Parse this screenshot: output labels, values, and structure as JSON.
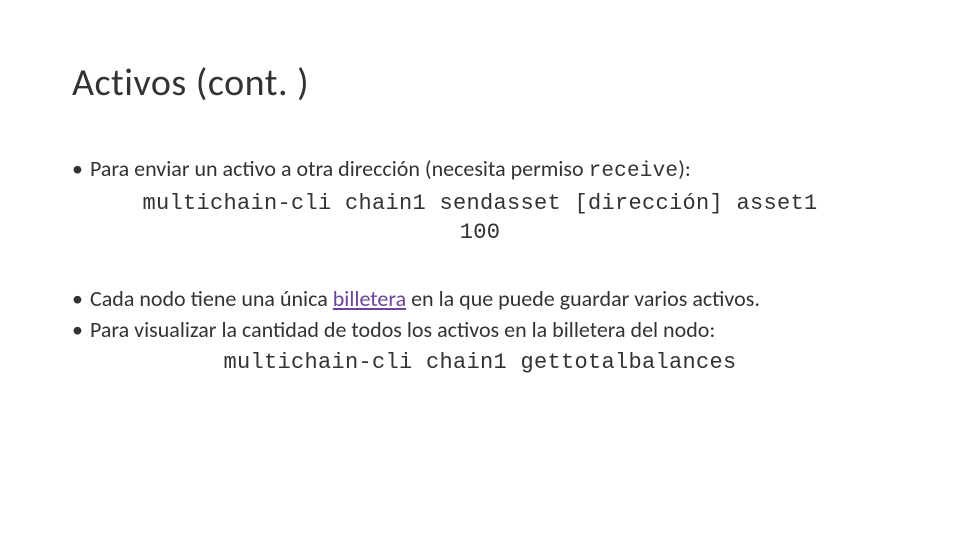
{
  "title": "Activos (cont. )",
  "bullet1": {
    "text_prefix": "Para enviar un activo a otra dirección (necesita permiso ",
    "code": "receive",
    "text_suffix": "):"
  },
  "code1": {
    "line1": "multichain-cli chain1 sendasset [dirección] asset1",
    "line2": "100"
  },
  "bullet2": {
    "text_prefix": "Cada nodo tiene una única ",
    "link": "billetera",
    "text_suffix": " en la que puede guardar varios activos."
  },
  "bullet3": {
    "text": "Para visualizar la cantidad de todos los activos en la billetera del nodo:"
  },
  "code2": {
    "line1": "multichain-cli chain1 gettotalbalances"
  }
}
